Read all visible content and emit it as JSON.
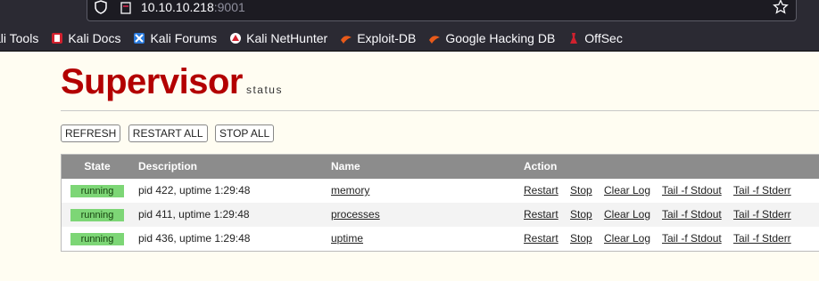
{
  "browser": {
    "url_host": "10.10.10.218",
    "url_port": ":9001",
    "bookmarks": [
      {
        "label": "ali Tools"
      },
      {
        "label": "Kali Docs"
      },
      {
        "label": "Kali Forums"
      },
      {
        "label": "Kali NetHunter"
      },
      {
        "label": "Exploit-DB"
      },
      {
        "label": "Google Hacking DB"
      },
      {
        "label": "OffSec"
      }
    ]
  },
  "header": {
    "logo": "Supervisor",
    "logo_sub": "status"
  },
  "buttons": {
    "refresh": "REFRESH",
    "restart_all": "RESTART ALL",
    "stop_all": "STOP ALL"
  },
  "table": {
    "headers": {
      "state": "State",
      "description": "Description",
      "name": "Name",
      "action": "Action"
    },
    "rows": [
      {
        "state": "running",
        "description": "pid 422, uptime 1:29:48",
        "name": "memory"
      },
      {
        "state": "running",
        "description": "pid 411, uptime 1:29:48",
        "name": "processes"
      },
      {
        "state": "running",
        "description": "pid 436, uptime 1:29:48",
        "name": "uptime"
      }
    ],
    "actions": {
      "restart": "Restart",
      "stop": "Stop",
      "clear_log": "Clear Log",
      "tail_stdout": "Tail -f Stdout",
      "tail_stderr": "Tail -f Stderr"
    }
  },
  "colors": {
    "brand_red": "#b30000",
    "running_green": "#7dd676",
    "header_gray": "#8c8c8c"
  }
}
